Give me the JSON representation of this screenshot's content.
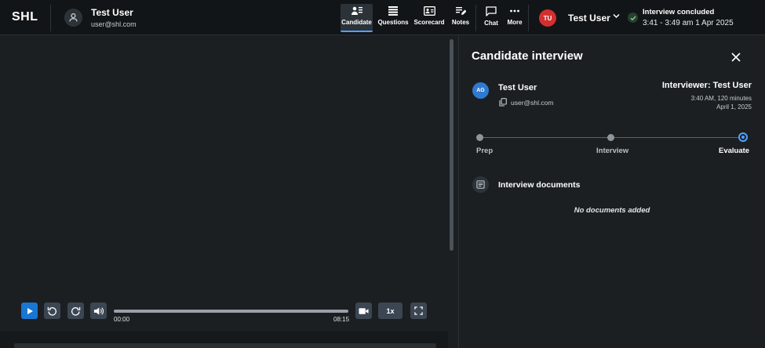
{
  "header": {
    "logo": "SHL",
    "user_name": "Test User",
    "user_email": "user@shl.com",
    "nav": [
      {
        "label": "Candidate",
        "icon": "candidate-icon",
        "active": true
      },
      {
        "label": "Questions",
        "icon": "questions-icon",
        "active": false
      },
      {
        "label": "Scorecard",
        "icon": "scorecard-icon",
        "active": false
      },
      {
        "label": "Notes",
        "icon": "notes-icon",
        "active": false
      },
      {
        "label": "Chat",
        "icon": "chat-icon",
        "active": false
      },
      {
        "label": "More",
        "icon": "more-icon",
        "active": false
      }
    ],
    "account_initials": "TU",
    "account_name": "Test User",
    "status_title": "Interview concluded",
    "status_time": "3:41 - 3:49 am 1 Apr 2025"
  },
  "player": {
    "current_time": "00:00",
    "duration": "08:15",
    "speed": "1x",
    "progress": 0
  },
  "panel": {
    "title": "Candidate interview",
    "candidate_initials": "AG",
    "candidate_name": "Test User",
    "candidate_email": "user@shl.com",
    "interviewer": "Interviewer: Test User",
    "interview_time": "3:40 AM, 120 minutes",
    "interview_date": "April 1, 2025",
    "steps": [
      {
        "label": "Prep",
        "state": "done"
      },
      {
        "label": "Interview",
        "state": "done"
      },
      {
        "label": "Evaluate",
        "state": "current"
      }
    ],
    "documents_title": "Interview documents",
    "documents_empty": "No documents added"
  },
  "colors": {
    "accent": "#1976d2",
    "account_avatar": "#d32f2f",
    "background": "#1b1f22"
  }
}
